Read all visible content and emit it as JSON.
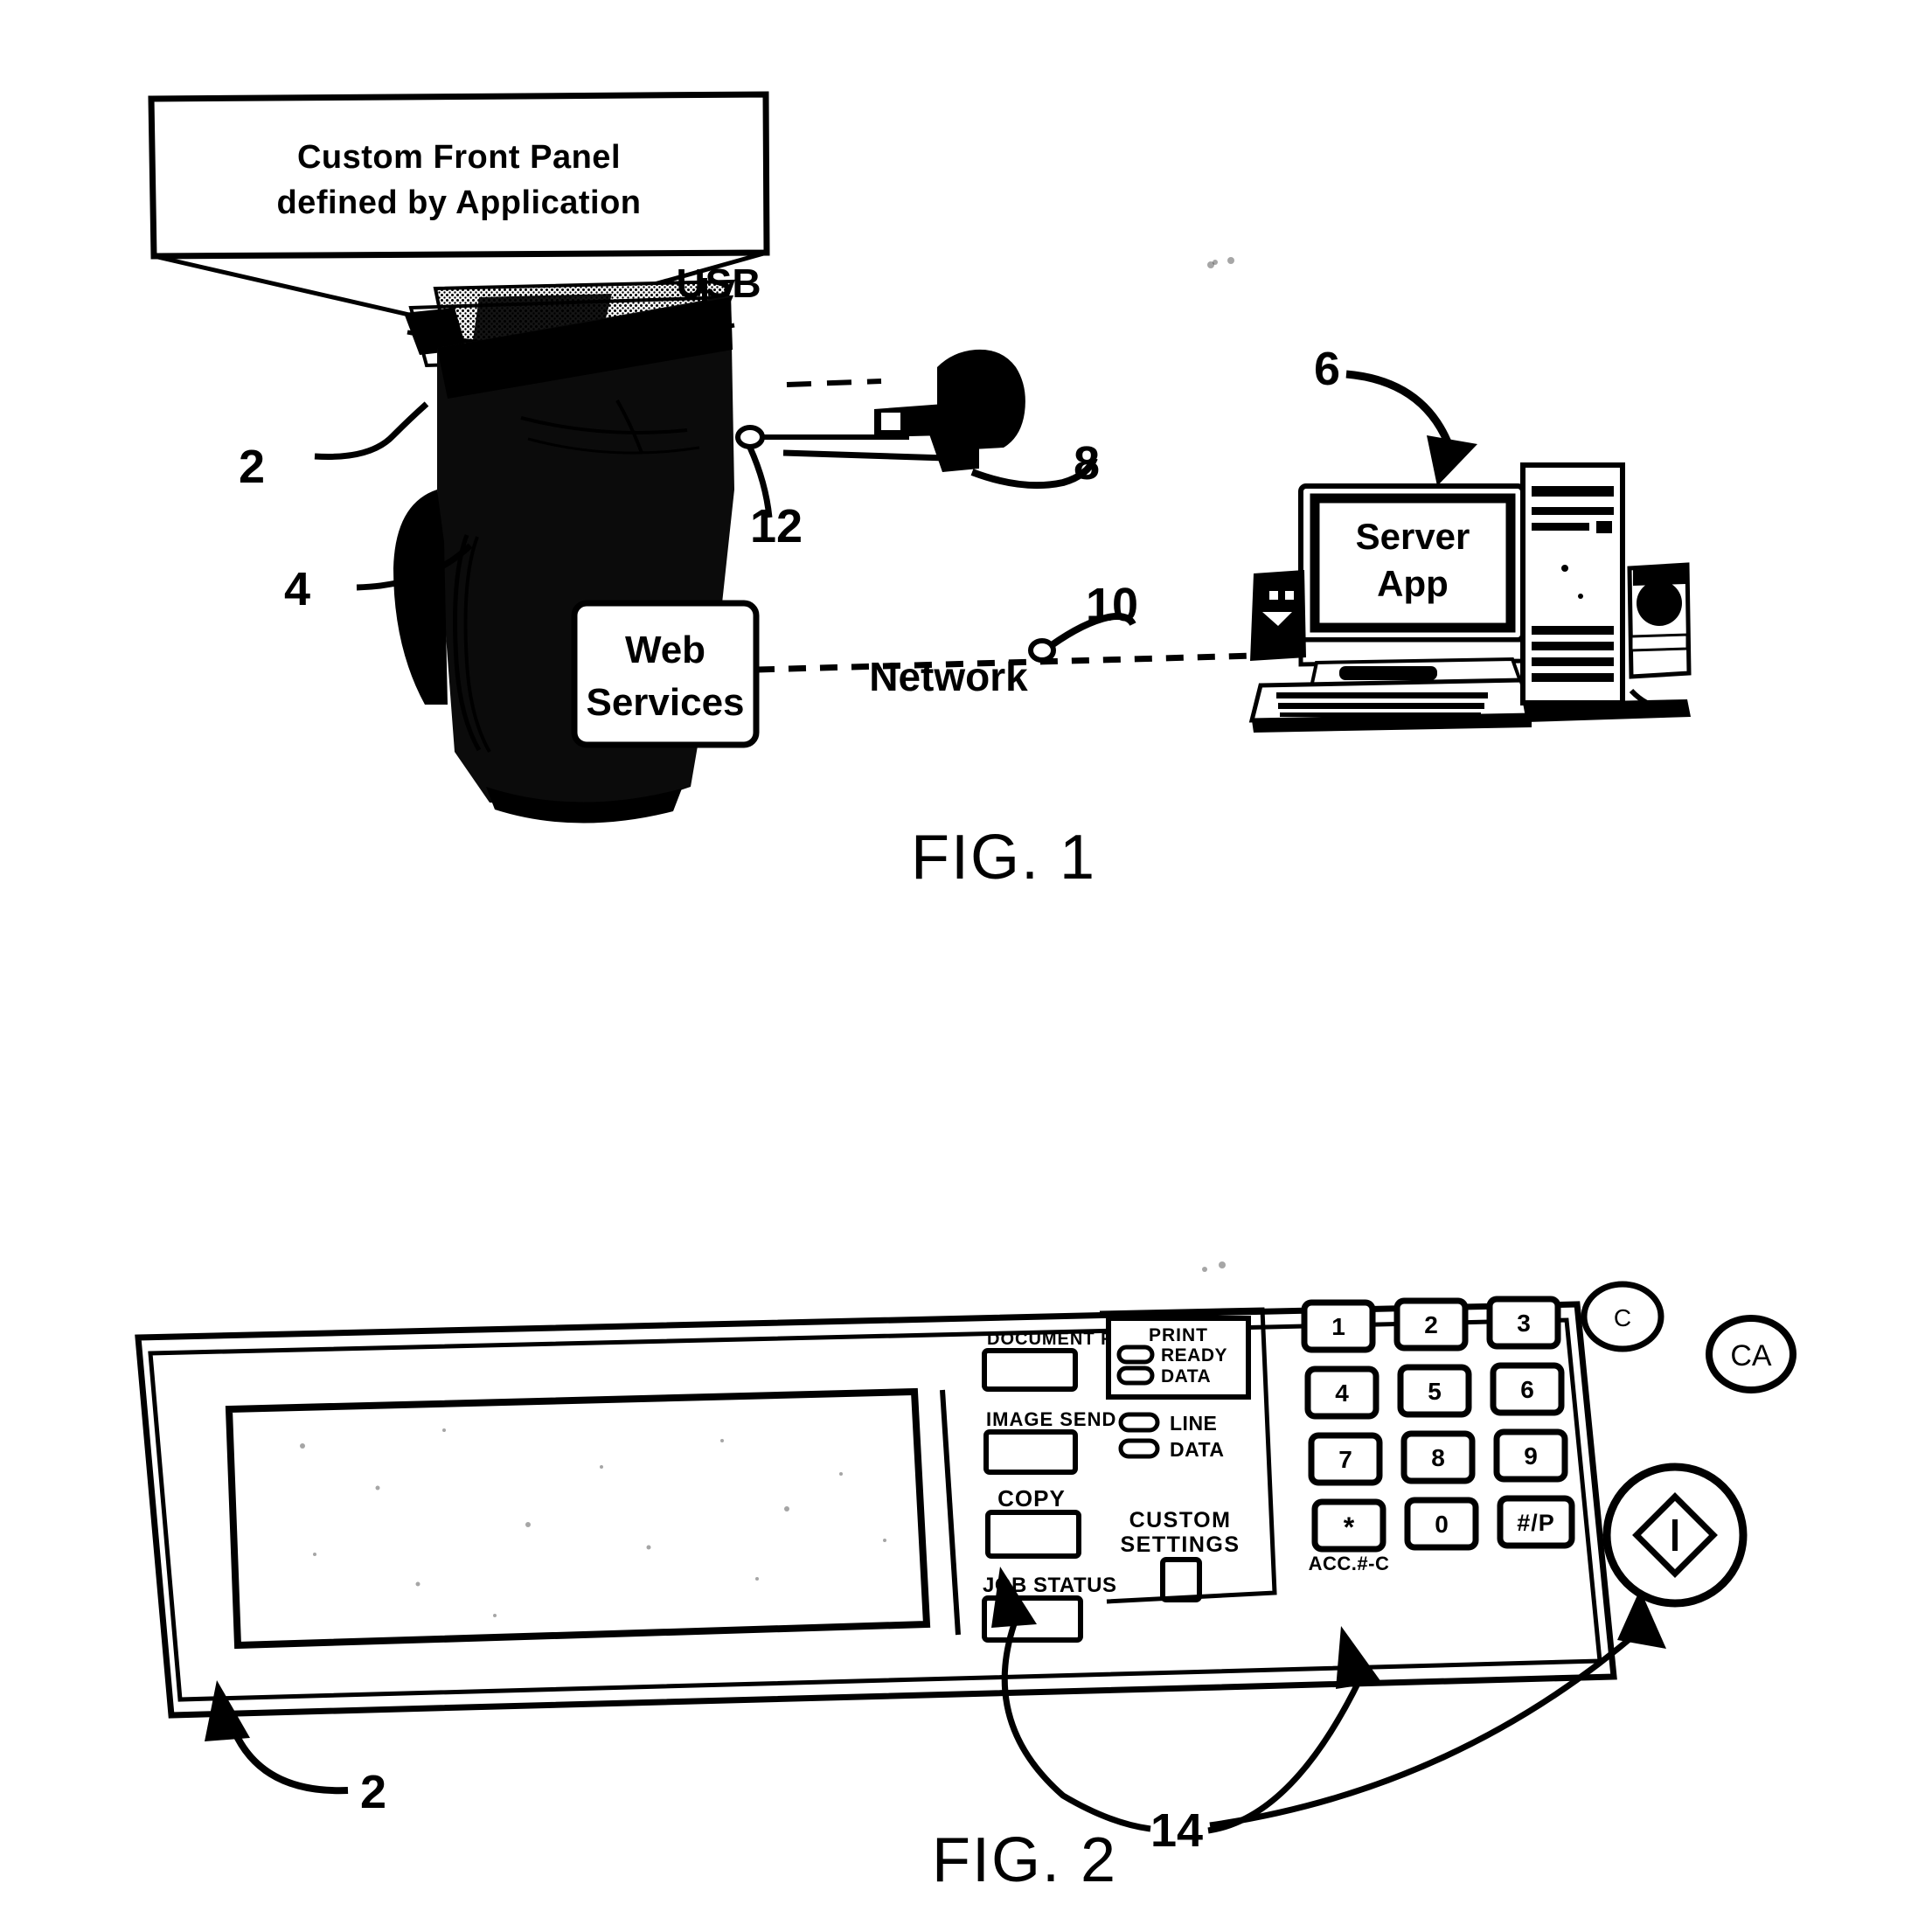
{
  "document": {
    "type": "patent-drawing-sheet",
    "figures": [
      {
        "id": "fig1",
        "caption": "FIG. 1",
        "callout_box": {
          "line1": "Custom Front Panel",
          "line2": "defined by Application"
        },
        "labels": {
          "usb": "USB",
          "web_services_line1": "Web",
          "web_services_line2": "Services",
          "network": "Network",
          "server_app_line1": "Server",
          "server_app_line2": "App"
        },
        "reference_numerals": [
          {
            "id": "ref-2",
            "value": "2"
          },
          {
            "id": "ref-4",
            "value": "4"
          },
          {
            "id": "ref-6",
            "value": "6"
          },
          {
            "id": "ref-8",
            "value": "8"
          },
          {
            "id": "ref-10",
            "value": "10"
          },
          {
            "id": "ref-12",
            "value": "12"
          }
        ]
      },
      {
        "id": "fig2",
        "caption": "FIG. 2",
        "mode_buttons": [
          {
            "label": "DOCUMENT FILING"
          },
          {
            "label": "IMAGE  SEND"
          },
          {
            "label": "COPY"
          },
          {
            "label": "JOB STATUS"
          }
        ],
        "indicator_panel": {
          "title": "PRINT",
          "lamps": [
            {
              "label": "READY"
            },
            {
              "label": "DATA"
            }
          ]
        },
        "secondary_lamps": [
          {
            "label": "LINE"
          },
          {
            "label": "DATA"
          }
        ],
        "custom_settings": {
          "line1": "CUSTOM",
          "line2": "SETTINGS"
        },
        "keypad": [
          {
            "label": "1"
          },
          {
            "label": "2"
          },
          {
            "label": "3"
          },
          {
            "label": "4"
          },
          {
            "label": "5"
          },
          {
            "label": "6"
          },
          {
            "label": "7"
          },
          {
            "label": "8"
          },
          {
            "label": "9"
          },
          {
            "label": "*"
          },
          {
            "label": "0"
          },
          {
            "label": "#/P"
          }
        ],
        "keypad_sublabel": "ACC.#-C",
        "round_buttons": [
          {
            "name": "clear-button",
            "label": "C"
          },
          {
            "name": "clear-all-button",
            "label": "CA"
          }
        ],
        "start_button": {
          "glyph": "diamond-start-icon"
        },
        "reference_numerals": [
          {
            "id": "ref-2-panel",
            "value": "2"
          },
          {
            "id": "ref-14",
            "value": "14"
          }
        ]
      }
    ]
  },
  "colors": {
    "ink": "#000000",
    "paper": "#ffffff",
    "halftone": "#1a1a1a"
  }
}
